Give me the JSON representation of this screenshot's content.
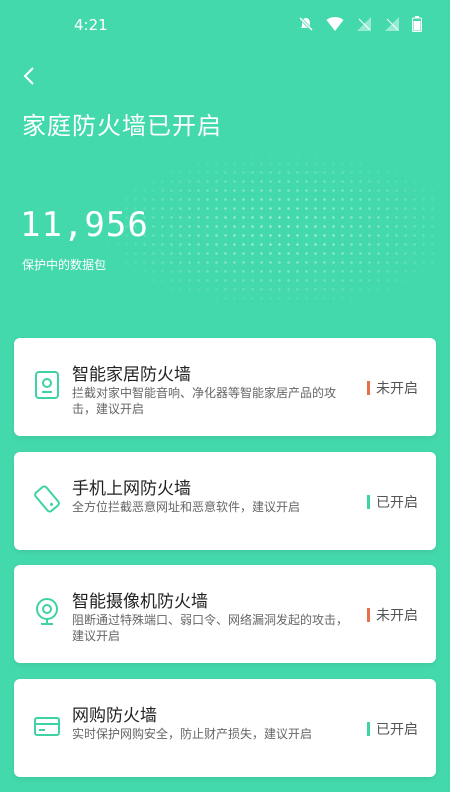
{
  "status_bar": {
    "time": "4:21"
  },
  "header": {
    "title": "家庭防火墙已开启"
  },
  "stats": {
    "count": "11,956",
    "label": "保护中的数据包"
  },
  "colors": {
    "background": "#44d9ad",
    "off": "#e86f4c",
    "on": "#3ed2a4"
  },
  "cards": [
    {
      "title": "智能家居防火墙",
      "desc": "拦截对家中智能音响、净化器等智能家居产品的攻击，建议开启",
      "status": "未开启",
      "state": "off",
      "icon": "smart-speaker-icon"
    },
    {
      "title": "手机上网防火墙",
      "desc": "全方位拦截恶意网址和恶意软件，建议开启",
      "status": "已开启",
      "state": "on",
      "icon": "phone-icon"
    },
    {
      "title": "智能摄像机防火墙",
      "desc": "阻断通过特殊端口、弱口令、网络漏洞发起的攻击，建议开启",
      "status": "未开启",
      "state": "off",
      "icon": "camera-icon"
    },
    {
      "title": "网购防火墙",
      "desc": "实时保护网购安全，防止财产损失，建议开启",
      "status": "已开启",
      "state": "on",
      "icon": "wallet-icon"
    }
  ]
}
